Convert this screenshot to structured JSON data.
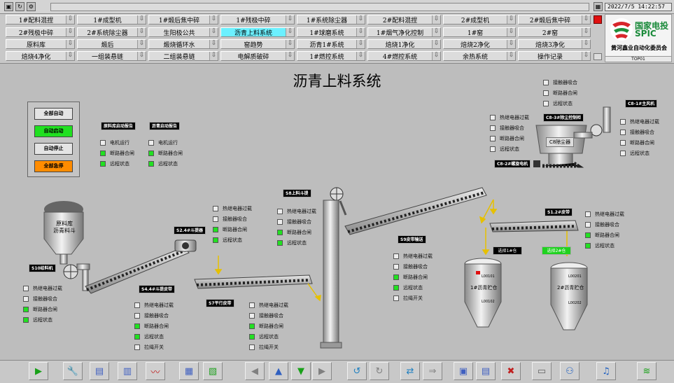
{
  "topbar": {
    "datetime": "2022/7/5 14:22:57"
  },
  "nav": {
    "row1": [
      "1#配料混捏",
      "1#成型机",
      "1#煅后焦中碎",
      "1#残极中碎",
      "1#系统除尘器",
      "2#配料混捏",
      "2#成型机",
      "2#煅后焦中碎"
    ],
    "row2": [
      "2#残极中碎",
      "2#系统除尘器",
      "生阳极公共",
      "沥青上料系统",
      "1#球磨系统",
      "1#烟气净化控制",
      "1#窑",
      "2#窑"
    ],
    "row3": [
      "原料库",
      "煅后",
      "煅烧循环水",
      "窑趋势",
      "沥青1#系统",
      "焙烧1净化",
      "焙烧2净化",
      "焙烧3净化"
    ],
    "row4": [
      "焙烧4净化",
      "一组装悬链",
      "二组装悬链",
      "电解质破碎",
      "1#燃控系统",
      "4#燃控系统",
      "余热系统",
      "操作记录"
    ]
  },
  "logo": {
    "cn": "国家电投",
    "en": "SPIC",
    "sub": "黄河鑫业自动化委员会",
    "code": "TOP01"
  },
  "page": {
    "title": "沥青上料系统"
  },
  "controls": {
    "all_auto": "全部自动",
    "auto_start": "自动启动",
    "auto_stop": "自动停止",
    "all_stop": "全部急停"
  },
  "status": {
    "motor_run": "电机运行",
    "breaker_close": "断路器合闸",
    "remote": "远程状态",
    "thermal_overload": "热继电器过载",
    "contactor": "接触器吸合",
    "pull_switch": "拉绳开关"
  },
  "tags": {
    "raw_start": "原料库启动报告",
    "pitch_start": "沥青启动报告",
    "s10": "S10给料机",
    "s2": "S2.4#斗提器",
    "s4": "S4.4#斗提皮带",
    "s7": "S7平行皮带",
    "s8": "S8上料斗提",
    "s9": "S9皮带输送",
    "s1": "S1.2#皮带",
    "c8_fan": "C8-1#主风机",
    "c8_panel": "C8-3#除尘控制柜",
    "c8_screw": "C8-2#螺旋电机"
  },
  "labels": {
    "raw_bin": "原料库",
    "raw_bin2": "沥青料斗",
    "dust": "C8除尘器",
    "silo1": "1#沥青贮仓",
    "silo2": "2#沥青贮仓",
    "select1": "选择1#仓",
    "select2": "选择2#仓",
    "s1_top": "L00101",
    "s1_bot": "L00102",
    "s2_top": "L00201",
    "s2_bot": "L00202"
  },
  "colors": {
    "green": "#22e022",
    "orange": "#ff8c00",
    "active_tab": "#6cf0ff"
  }
}
